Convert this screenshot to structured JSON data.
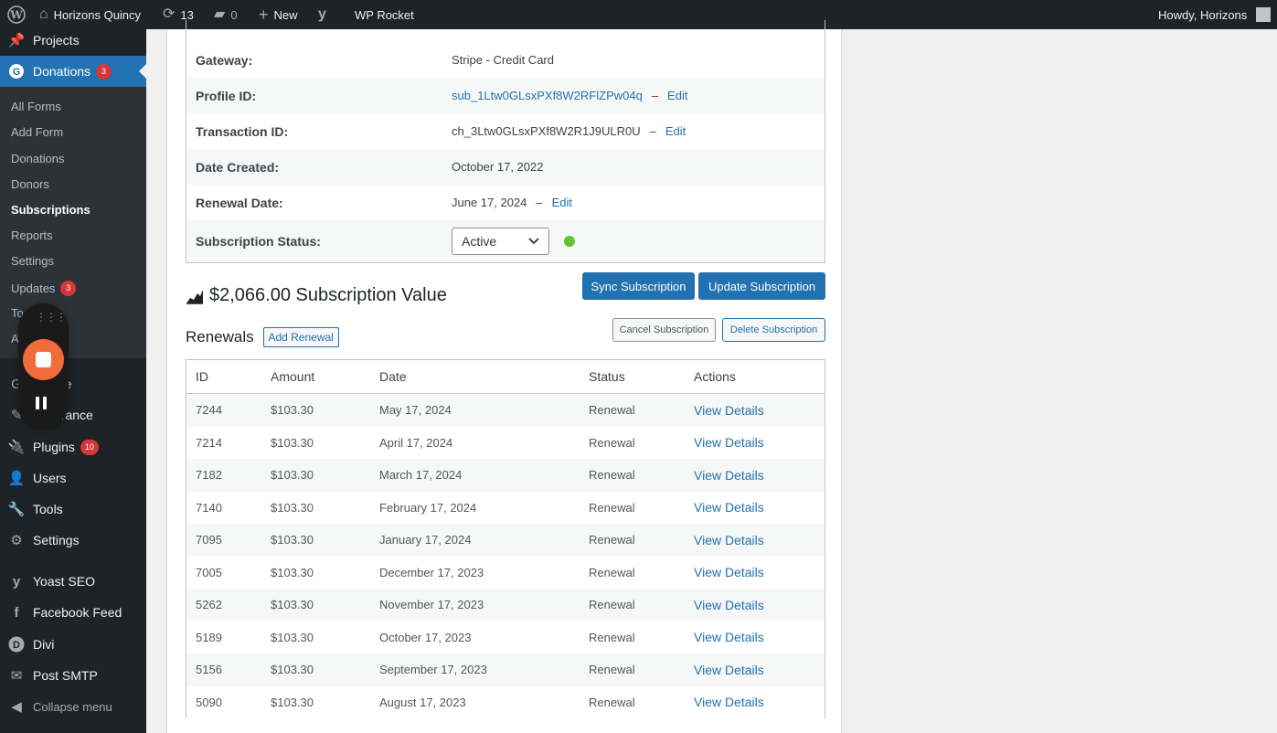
{
  "adminbar": {
    "site_name": "Horizons Quincy",
    "updates_count": "13",
    "comments_count": "0",
    "new_label": "New",
    "wp_rocket": "WP Rocket",
    "howdy": "Howdy, Horizons"
  },
  "sidebar": {
    "top_items": [
      {
        "label": "Projects",
        "icon": "pin-icon"
      },
      {
        "label": "Donations",
        "badge": "3",
        "icon": "give-icon"
      },
      {
        "label": "me",
        "icon": "theme-icon"
      },
      {
        "label": "arance",
        "icon": "appearance-icon"
      },
      {
        "label": "Plugins",
        "badge": "10",
        "icon": "plugins-icon"
      },
      {
        "label": "Users",
        "icon": "users-icon"
      },
      {
        "label": "Tools",
        "icon": "tools-icon"
      },
      {
        "label": "Settings",
        "icon": "settings-icon"
      },
      {
        "label": "Yoast SEO",
        "icon": "yoast-icon"
      },
      {
        "label": "Facebook Feed",
        "icon": "facebook-icon"
      },
      {
        "label": "Divi",
        "icon": "divi-icon"
      },
      {
        "label": "Post SMTP",
        "icon": "mail-icon"
      },
      {
        "label": "Collapse menu",
        "icon": "collapse-icon"
      }
    ],
    "submenu": [
      {
        "label": "All Forms"
      },
      {
        "label": "Add Form"
      },
      {
        "label": "Donations"
      },
      {
        "label": "Donors"
      },
      {
        "label": "Subscriptions"
      },
      {
        "label": "Reports"
      },
      {
        "label": "Settings"
      },
      {
        "label": "Updates",
        "badge": "3"
      },
      {
        "label": "To"
      },
      {
        "label": "A"
      }
    ]
  },
  "details": {
    "rows": [
      {
        "label": "Gateway:",
        "value": "Stripe - Credit Card"
      },
      {
        "label": "Profile ID:",
        "value": "sub_1Ltw0GLsxPXf8W2RFlZPw04q",
        "edit": "Edit"
      },
      {
        "label": "Transaction ID:",
        "value": "ch_3Ltw0GLsxPXf8W2R1J9ULR0U",
        "edit": "Edit"
      },
      {
        "label": "Date Created:",
        "value": "October 17, 2022"
      },
      {
        "label": "Renewal Date:",
        "value": "June 17, 2024",
        "edit": "Edit"
      },
      {
        "label": "Subscription Status:",
        "value": "Active"
      }
    ],
    "status_color": "#5ec72f"
  },
  "actions": {
    "sync": "Sync Subscription",
    "update": "Update Subscription",
    "cancel": "Cancel Subscription",
    "delete": "Delete Subscription"
  },
  "subscription_value": "$2,066.00 Subscription Value",
  "renewals": {
    "title": "Renewals",
    "add_button": "Add Renewal",
    "columns": [
      "ID",
      "Amount",
      "Date",
      "Status",
      "Actions"
    ],
    "rows": [
      {
        "id": "7244",
        "amount": "$103.30",
        "date": "May 17, 2024",
        "status": "Renewal",
        "action": "View Details"
      },
      {
        "id": "7214",
        "amount": "$103.30",
        "date": "April 17, 2024",
        "status": "Renewal",
        "action": "View Details"
      },
      {
        "id": "7182",
        "amount": "$103.30",
        "date": "March 17, 2024",
        "status": "Renewal",
        "action": "View Details"
      },
      {
        "id": "7140",
        "amount": "$103.30",
        "date": "February 17, 2024",
        "status": "Renewal",
        "action": "View Details"
      },
      {
        "id": "7095",
        "amount": "$103.30",
        "date": "January 17, 2024",
        "status": "Renewal",
        "action": "View Details"
      },
      {
        "id": "7005",
        "amount": "$103.30",
        "date": "December 17, 2023",
        "status": "Renewal",
        "action": "View Details"
      },
      {
        "id": "5262",
        "amount": "$103.30",
        "date": "November 17, 2023",
        "status": "Renewal",
        "action": "View Details"
      },
      {
        "id": "5189",
        "amount": "$103.30",
        "date": "October 17, 2023",
        "status": "Renewal",
        "action": "View Details"
      },
      {
        "id": "5156",
        "amount": "$103.30",
        "date": "September 17, 2023",
        "status": "Renewal",
        "action": "View Details"
      },
      {
        "id": "5090",
        "amount": "$103.30",
        "date": "August 17, 2023",
        "status": "Renewal",
        "action": "View Details"
      }
    ]
  }
}
